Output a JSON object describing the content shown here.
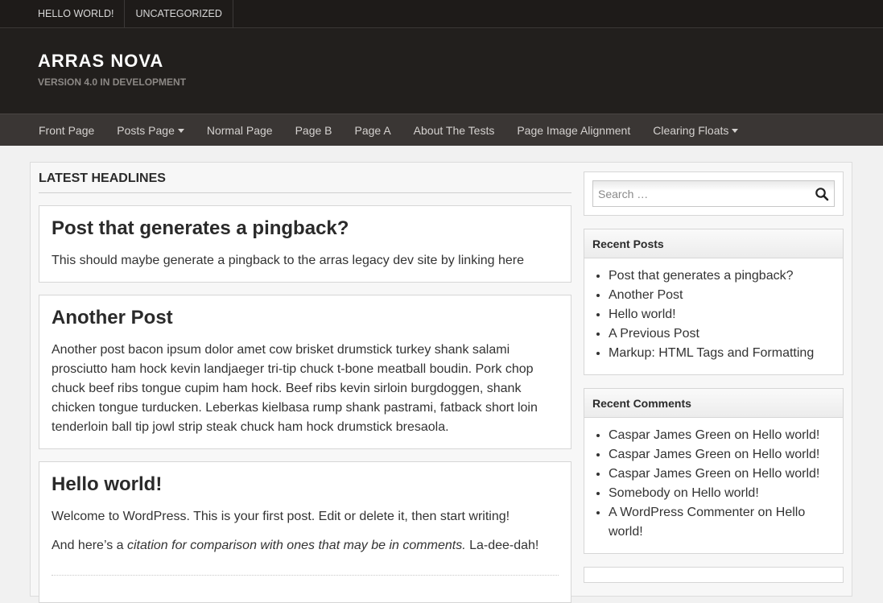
{
  "topbar": {
    "items": [
      "HELLO WORLD!",
      "UNCATEGORIZED"
    ]
  },
  "header": {
    "title": "ARRAS NOVA",
    "description": "VERSION 4.0 IN DEVELOPMENT"
  },
  "nav": {
    "items": [
      {
        "label": "Front Page"
      },
      {
        "label": "Posts Page"
      },
      {
        "label": "Normal Page"
      },
      {
        "label": "Page B"
      },
      {
        "label": "Page A"
      },
      {
        "label": "About The Tests"
      },
      {
        "label": "Page Image Alignment"
      },
      {
        "label": "Clearing Floats"
      }
    ]
  },
  "main": {
    "section_title": "LATEST HEADLINES",
    "posts": [
      {
        "title": "Post that generates a pingback?",
        "body": "This should maybe generate a pingback to the arras legacy dev site by linking here"
      },
      {
        "title": "Another Post",
        "body": "Another post bacon ipsum dolor amet cow brisket drumstick turkey shank salami prosciutto ham hock kevin landjaeger tri-tip chuck t-bone meatball boudin. Pork chop chuck beef ribs tongue cupim ham hock. Beef ribs kevin sirloin burgdoggen, shank chicken tongue turducken. Leberkas kielbasa rump shank pastrami, fatback short loin tenderloin ball tip jowl strip steak chuck ham hock drumstick bresaola."
      },
      {
        "title": "Hello world!",
        "body": "Welcome to WordPress. This is your first post. Edit or delete it, then start writing!",
        "body2_pre": "And here’s a ",
        "body2_em": "citation for comparison with ones that may be in comments.",
        "body2_post": " La-dee-dah!"
      }
    ]
  },
  "sidebar": {
    "search": {
      "placeholder": "Search …"
    },
    "recent_posts": {
      "title": "Recent Posts",
      "items": [
        "Post that generates a pingback?",
        "Another Post",
        "Hello world!",
        "A Previous Post",
        "Markup: HTML Tags and Formatting"
      ]
    },
    "recent_comments": {
      "title": "Recent Comments",
      "items": [
        {
          "author": "Caspar James Green",
          "on": " on ",
          "post": "Hello world!"
        },
        {
          "author": "Caspar James Green",
          "on": " on ",
          "post": "Hello world!"
        },
        {
          "author": "Caspar James Green",
          "on": " on ",
          "post": "Hello world!"
        },
        {
          "author": "Somebody",
          "on": " on ",
          "post": "Hello world!"
        },
        {
          "author": "A WordPress Commenter",
          "on": " on ",
          "post": "Hello world!"
        }
      ]
    }
  },
  "colors": {
    "topbar": "#1e1b19",
    "header": "#221f1d",
    "nav": "#3a3634",
    "page": "#f1f1f1"
  },
  "icons": {
    "search": "search-icon",
    "dropdown": "caret-down-icon"
  }
}
